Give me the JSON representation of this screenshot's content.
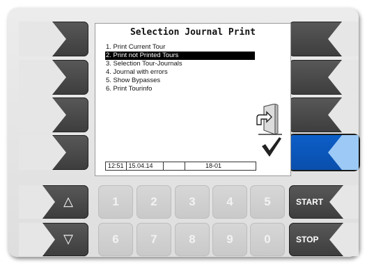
{
  "screen": {
    "title": "Selection Journal Print",
    "menu_items": [
      "1.  Print Current Tour",
      "2.  Print not Printed Tours",
      "3.  Selection Tour-Journals",
      "4.  Journal with errors",
      "5.  Show Bypasses",
      "6.  Print Tourinfo"
    ],
    "selected_index": 1,
    "status": {
      "time": "12:51",
      "date": "15.04.14",
      "empty": "",
      "code": "18-01"
    }
  },
  "keypad": {
    "digits_top": [
      "1",
      "2",
      "3",
      "4",
      "5"
    ],
    "digits_bottom": [
      "6",
      "7",
      "8",
      "9",
      "0"
    ],
    "up_arrow": "△",
    "down_arrow": "▽",
    "start_label": "START",
    "stop_label": "STOP"
  },
  "colors": {
    "softkey_dark": "#4a4a4a",
    "softkey_active": "#0b57be",
    "arrow_active": "#9cc9f5",
    "arrow_inactive": "#e6e6e6"
  }
}
